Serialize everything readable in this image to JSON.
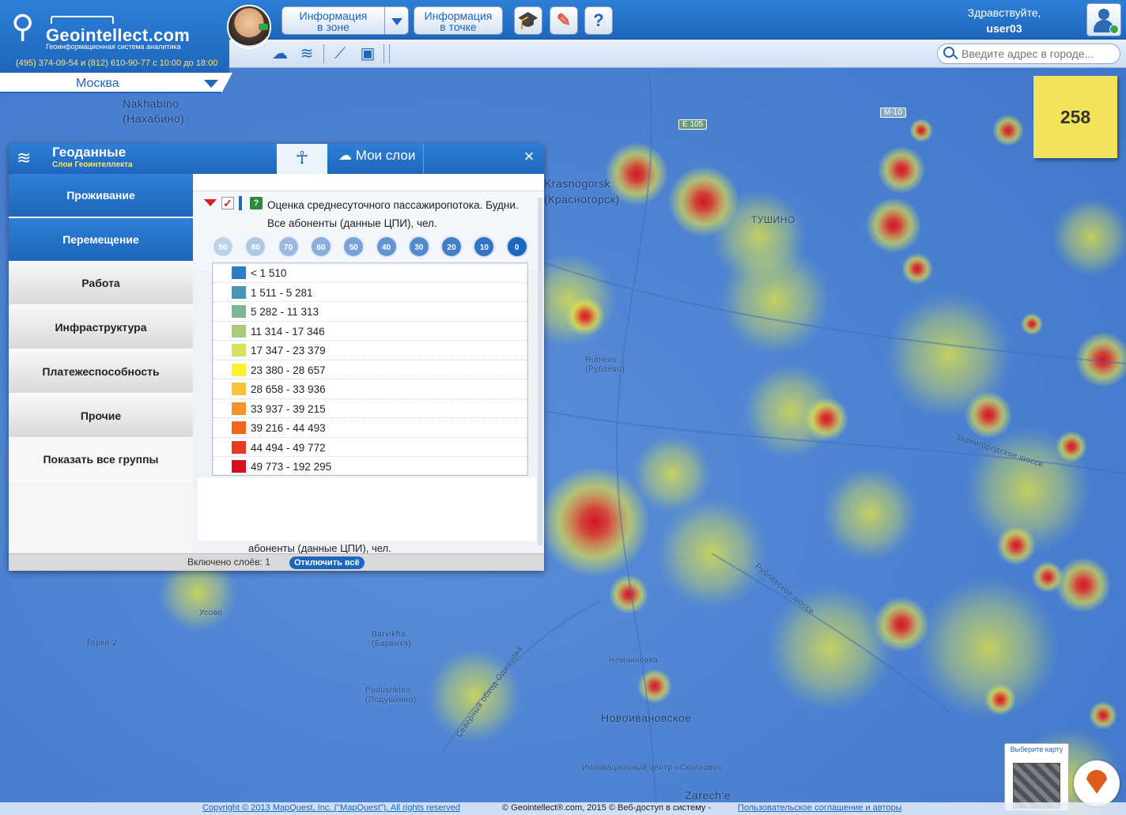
{
  "header": {
    "logo_name": "Geointellect",
    "logo_suffix": ".com",
    "logo_tagline": "Геоинформационная система аналитика",
    "phone": "(495) 374-09-54 и (812) 610-90-77 с 10:00 до 18:00",
    "city": "Москва",
    "btn_zone": [
      "Информация",
      "в зоне"
    ],
    "btn_point": [
      "Информация",
      "в точке"
    ],
    "greeting": "Здравствуйте,",
    "user": "user03",
    "search_placeholder": "Введите адрес в городе..."
  },
  "sticky_value": "258",
  "panel": {
    "title": "Геоданные",
    "subtitle": "Слои Геоинтеллекта",
    "tab_my_layers": "Мои слои",
    "close": "×",
    "sidebar": [
      {
        "label": "Проживание",
        "state": "active"
      },
      {
        "label": "Перемещение",
        "state": "active"
      },
      {
        "label": "Работа",
        "state": "normal"
      },
      {
        "label": "Инфраструктура",
        "state": "normal"
      },
      {
        "label": "Платежеспособность",
        "state": "normal"
      },
      {
        "label": "Прочие",
        "state": "normal"
      },
      {
        "label": "Показать все группы",
        "state": "white"
      }
    ],
    "layer_title": "Оценка среднесуточного пассажиропотока. Будни. Все абоненты (данные ЦПИ), чел.",
    "opacity_steps": [
      "90",
      "80",
      "70",
      "60",
      "50",
      "40",
      "30",
      "20",
      "10",
      "0"
    ],
    "legend": [
      {
        "label": "< 1 510",
        "color": "#2a7fc4"
      },
      {
        "label": "1 511 - 5 281",
        "color": "#4a94b4"
      },
      {
        "label": "5 282 - 11 313",
        "color": "#7db49a"
      },
      {
        "label": "11 314 - 17 346",
        "color": "#a8cc7a"
      },
      {
        "label": "17 347 - 23 379",
        "color": "#d6e25a"
      },
      {
        "label": "23 380 - 28 657",
        "color": "#f8f230"
      },
      {
        "label": "28 658 - 33 936",
        "color": "#f8c23a"
      },
      {
        "label": "33 937 - 39 215",
        "color": "#f6922a"
      },
      {
        "label": "39 216 - 44 493",
        "color": "#f0661e"
      },
      {
        "label": "44 494 - 49 772",
        "color": "#e83a1e"
      },
      {
        "label": "49 773 - 192 295",
        "color": "#d8101e"
      }
    ],
    "clipped_text": "абоненты (данные ЦПИ), чел.",
    "layers_on": "Включено слоёв: 1",
    "disable_all": "Отключить всё"
  },
  "map_labels": {
    "nakhabino": "Nakhabino",
    "nakhabino_ru": "(Нахабино)",
    "krasnogorsk": "Krasnogorsk",
    "krasnogorsk_ru": "(Красногорск)",
    "tushino": "ТУШИНО",
    "rublevo": "Rublevo",
    "rublevo_ru": "(Рублёво)",
    "barvikha": "Barvikha",
    "barvikha_ru": "(Барвиха)",
    "podushkino": "Podushkino",
    "podushkino_ru": "(Подушкино)",
    "gorki2": "Горки-2",
    "uspenskoe": "Усово",
    "novoivanovskoe": "Новоивановское",
    "nemchinovka": "Немчиновка",
    "skolkovo": "Инновационный центр «Сколково»",
    "zarechye": "Zarech'e",
    "zvenigorodskoe": "Звенигородское шоссе",
    "rublevskoe": "Рублёвское шоссе",
    "severny": "Северный обход Одинцова",
    "e105": "E 105",
    "m10": "M-10"
  },
  "map_selector": "Выберите карту",
  "footer": {
    "copy1": "Copyright © 2013 MapQuest, Inc. (\"MapQuest\"). All rights reserved",
    "copy2": "© Geointellect®.com, 2015 © Веб-доступ в систему -",
    "copy3": "Пользовательское соглашение и авторы"
  }
}
